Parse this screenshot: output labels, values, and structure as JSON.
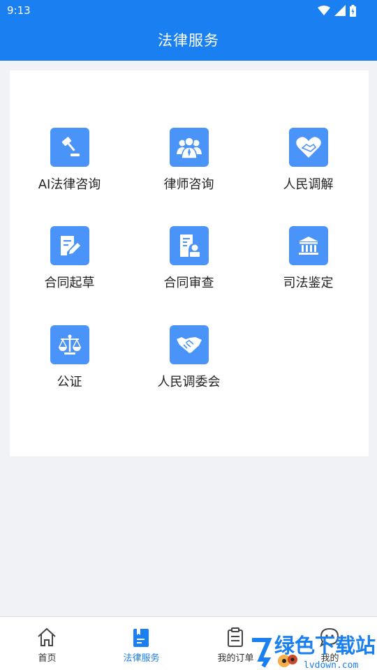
{
  "status": {
    "time": "9:13"
  },
  "header": {
    "title": "法律服务"
  },
  "services": [
    {
      "label": "AI法律咨询",
      "icon": "gavel-icon"
    },
    {
      "label": "律师咨询",
      "icon": "lawyer-group-icon"
    },
    {
      "label": "人民调解",
      "icon": "heart-handshake-icon"
    },
    {
      "label": "合同起草",
      "icon": "document-edit-icon"
    },
    {
      "label": "合同审查",
      "icon": "document-review-icon"
    },
    {
      "label": "司法鉴定",
      "icon": "courthouse-icon"
    },
    {
      "label": "公证",
      "icon": "scales-icon"
    },
    {
      "label": "人民调委会",
      "icon": "handshake-icon"
    }
  ],
  "tabs": [
    {
      "label": "首页",
      "icon": "home-icon"
    },
    {
      "label": "法律服务",
      "icon": "law-book-icon",
      "active": true
    },
    {
      "label": "我的订单",
      "icon": "clipboard-icon"
    },
    {
      "label": "我的",
      "icon": "chat-face-icon"
    }
  ],
  "watermark": {
    "text": "绿色下载站",
    "url": "lvdown.com"
  },
  "colors": {
    "primary": "#1a7ff0",
    "tile": "#4a93f8"
  }
}
